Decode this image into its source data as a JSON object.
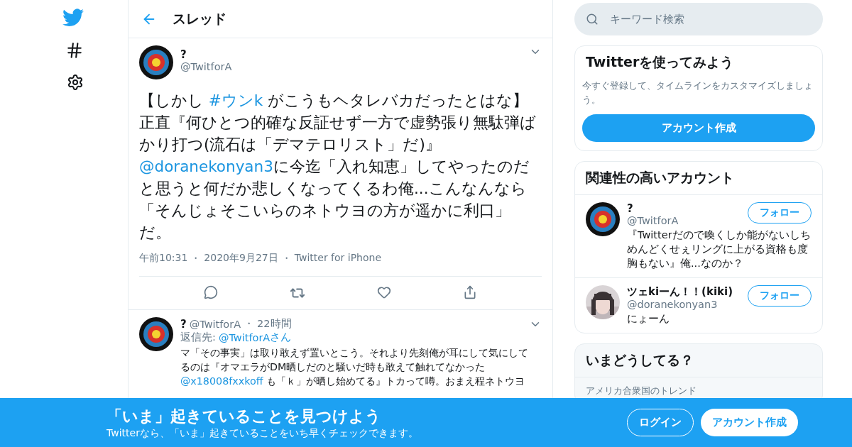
{
  "header": {
    "title": "スレッド"
  },
  "tweet": {
    "name": "?",
    "handle": "@TwitforA",
    "body": [
      {
        "kind": "text",
        "text": "【しかし "
      },
      {
        "kind": "link",
        "text": "#ウンk"
      },
      {
        "kind": "text",
        "text": " がこうもヘタレバカだったとはな】正直『何ひとつ的確な反証せず一方で虚勢張り無駄弾ばかり打つ(流石は「デマテロリスト」だ)』"
      },
      {
        "kind": "link",
        "text": "@doranekonyan3"
      },
      {
        "kind": "text",
        "text": "に今迄「入れ知恵」してやったのだと思うと何だか悲しくなってくるわ俺...こんなんなら「そんじょそこいらのネトウヨの方が遥かに利口」だ。"
      }
    ],
    "meta": [
      "午前10:31",
      "2020年9月27日",
      "Twitter for iPhone"
    ],
    "separator": "・"
  },
  "reply": {
    "name": "?",
    "handle": "@TwitforA",
    "separator": "・",
    "time": "22時間",
    "reply_to_label": "返信先:",
    "reply_to": "@TwitforA",
    "reply_to_suffix": "さん",
    "body": [
      {
        "kind": "text",
        "text": "マ「その事実」は取り敢えず置いとこう。それより先刻俺が耳にして気にしてるのは『オマエラがDM晒しだのと騒いだ時も敢えて触れてなかった"
      },
      {
        "kind": "link",
        "text": "@x18008fxxkoff"
      },
      {
        "kind": "text",
        "text": " も「ｋ」が晒し始めてる』トカって噂。おまえ程ネトウヨ"
      }
    ]
  },
  "search": {
    "placeholder": "キーワード検索"
  },
  "signup_card": {
    "title": "Twitterを使ってみよう",
    "text": "今すぐ登録して、タイムラインをカスタマイズしましょう。",
    "button": "アカウント作成"
  },
  "related": {
    "title": "関連性の高いアカウント",
    "accounts": [
      {
        "kind": "target",
        "name": "?",
        "handle": "@TwitforA",
        "bio": "『Twitterだので喚くしか能がないしちめんどくせぇリングに上がる資格も度胸もない』俺...なのか？",
        "button": "フォロー"
      },
      {
        "kind": "picture",
        "name": "ツェkiーん！！(kiki)",
        "handle": "@doranekonyan3",
        "bio": "にょーん",
        "button": "フォロー"
      }
    ]
  },
  "trends": {
    "title": "いまどうしてる？",
    "subtitle": "アメリカ合衆国のトレンド"
  },
  "banner": {
    "title": "「いま」起きていることを見つけよう",
    "text": "Twitterなら、「いま」起きていることをいち早くチェックできます。",
    "login": "ログイン",
    "signup": "アカウント作成"
  }
}
